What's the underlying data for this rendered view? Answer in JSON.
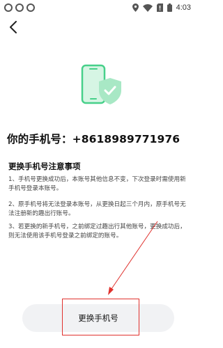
{
  "status_bar": {
    "time": "4:03",
    "icons": [
      "notification-dot-icon",
      "notification-dot-icon",
      "notification-dot-icon",
      "location-icon",
      "wifi-icon",
      "sim-icon",
      "battery-icon"
    ]
  },
  "header": {
    "back_icon": "back-arrow-icon"
  },
  "main": {
    "illustration_icon": "phone-shield-icon",
    "phone_title": "你的手机号：+8618989771976",
    "notice_heading": "更换手机号注意事项",
    "notice_items": [
      "1、手机号更换成功后，本账号其他信息不变，下次登录时需使用新手机号登录本账号。",
      "2、原手机号将无法登录本账号，从更换日起三个月内，原手机号无法注册新的趣出行账号。",
      "3、若更换的新手机号，之前绑定过趣出行其他账号，更换成功后，则无法使用该手机号登录之前绑定的账号。"
    ]
  },
  "footer": {
    "change_button_label": "更换手机号"
  },
  "colors": {
    "accent_green": "#47d08a",
    "annotation_red": "#e0312d",
    "button_bg": "#f1f2f4"
  }
}
